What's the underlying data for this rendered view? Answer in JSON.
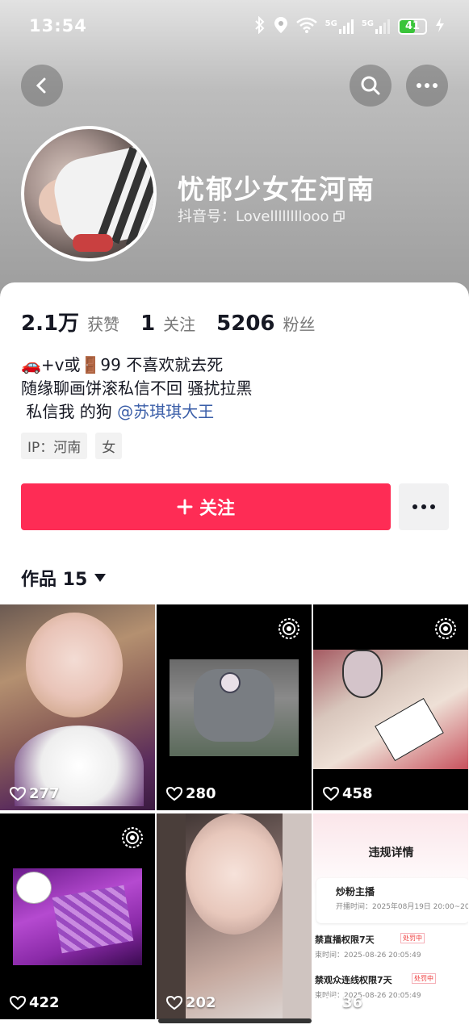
{
  "status_bar": {
    "time": "13:54",
    "net1": "5G",
    "net2": "5G",
    "battery": "41"
  },
  "profile": {
    "name": "忧郁少女在河南",
    "douyin_id": "抖音号：Lovellllllllooo"
  },
  "stats": [
    {
      "value": "2.1万",
      "label": "获赞"
    },
    {
      "value": "1",
      "label": "关注"
    },
    {
      "value": "5206",
      "label": "粉丝"
    }
  ],
  "bio": {
    "line1": "🚗+v或🚪99 不喜欢就去死",
    "line2": "随缘聊画饼滚私信不回 骚扰拉黑",
    "line3_prefix": " 私信我 的狗 ",
    "line3_mention": "@苏琪琪大王"
  },
  "tags": {
    "ip": "IP：河南",
    "gender": "女"
  },
  "actions": {
    "follow_label": "关注",
    "more_label": "•••"
  },
  "works": {
    "label": "作品 15"
  },
  "videos": [
    {
      "likes": "277"
    },
    {
      "likes": "280"
    },
    {
      "likes": "458"
    },
    {
      "likes": "422"
    },
    {
      "likes": "202"
    },
    {
      "likes": "36"
    }
  ],
  "notice_tile": {
    "title": "违规详情",
    "item1": "炒粉主播",
    "item1_time": "开播时间：2025年08月19日 20:00~20:0",
    "item2": "禁直播权限7天",
    "item2_badge": "处罚中",
    "item2_time": "束时间：2025-08-26 20:05:49",
    "item3": "禁观众连线权限7天",
    "item3_badge": "处罚中",
    "item3_time": "束时间：2025-08-26 20:05:49"
  },
  "colors": {
    "accent": "#fe2c55",
    "mention": "#3a5ea8"
  }
}
